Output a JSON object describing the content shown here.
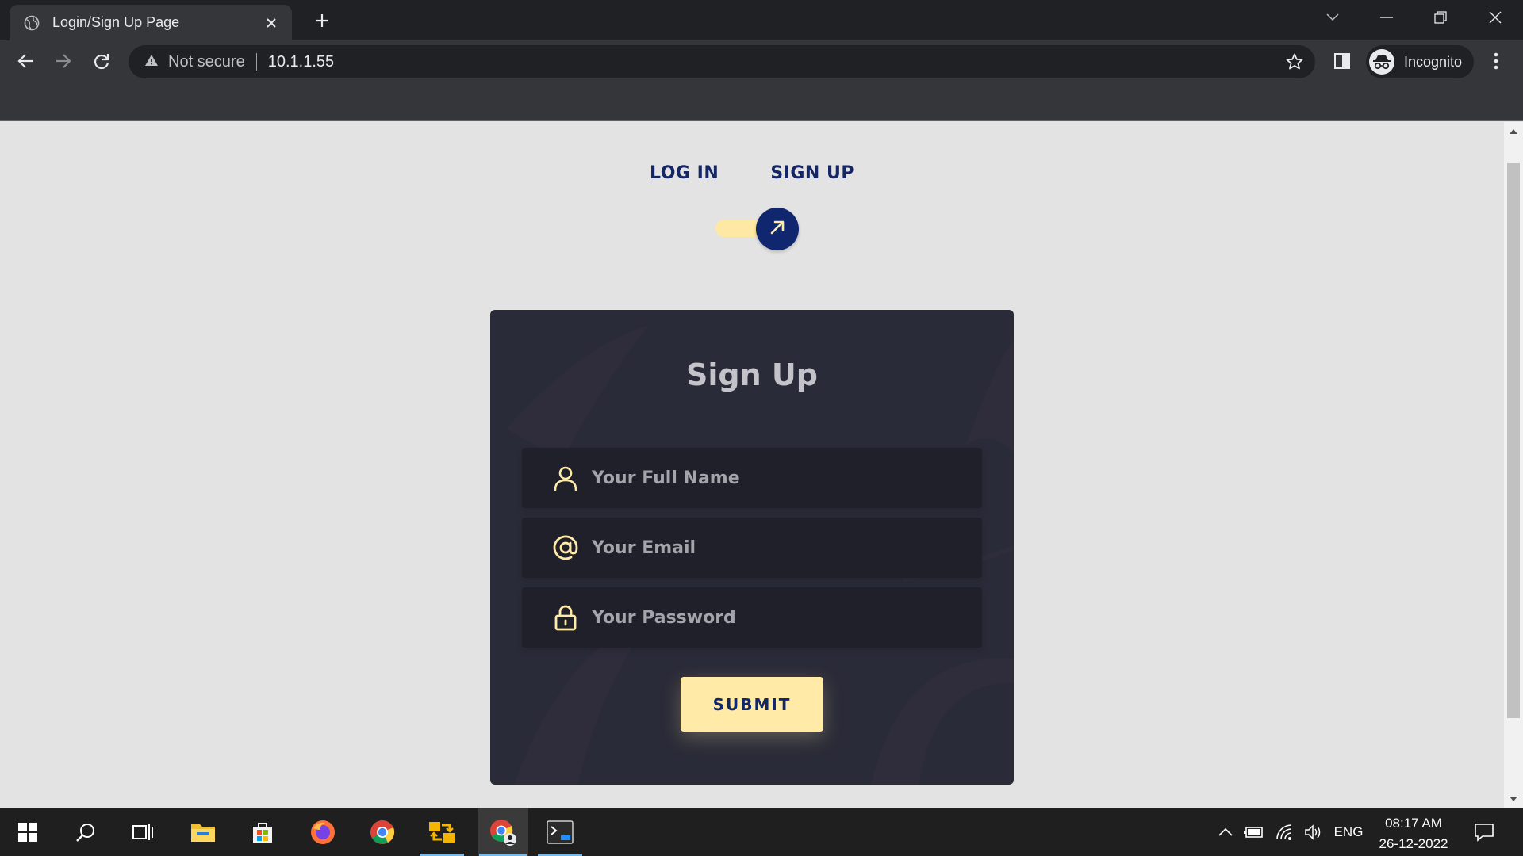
{
  "browser": {
    "tab_title": "Login/Sign Up Page",
    "security_label": "Not secure",
    "url": "10.1.1.55",
    "profile_label": "Incognito"
  },
  "page": {
    "switch": {
      "login_label": "LOG IN",
      "signup_label": "SIGN UP",
      "checked": true
    },
    "signup_form": {
      "title": "Sign Up",
      "fullname_placeholder": "Your Full Name",
      "email_placeholder": "Your Email",
      "password_placeholder": "Your Password",
      "submit_label": "SUBMIT"
    }
  },
  "taskbar": {
    "apps": [
      "windows-start",
      "search",
      "task-view",
      "file-explorer",
      "microsoft-store",
      "firefox",
      "chrome",
      "vmware",
      "chrome-incognito",
      "terminal"
    ],
    "language": "ENG",
    "time": "08:17 AM",
    "date": "26-12-2022"
  },
  "colors": {
    "accent_yellow": "#ffeba7",
    "navy": "#102770",
    "card_bg": "#2a2b38",
    "field_bg": "#1f2029",
    "page_bg": "#e3e3e3"
  }
}
